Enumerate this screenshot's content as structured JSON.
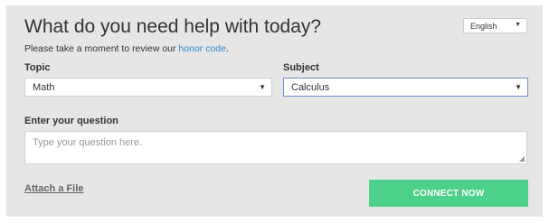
{
  "header": {
    "title": "What do you need help with today?",
    "subline_prefix": "Please take a moment to review our ",
    "honor_code_link": "honor code",
    "subline_suffix": "."
  },
  "language_select": {
    "value": "English",
    "caret": "▼"
  },
  "topic": {
    "label": "Topic",
    "value": "Math",
    "caret": "▼"
  },
  "subject": {
    "label": "Subject",
    "value": "Calculus",
    "caret": "▼"
  },
  "question": {
    "label": "Enter your question",
    "placeholder": "Type your question here.",
    "value": ""
  },
  "actions": {
    "attach_label": "Attach a File",
    "connect_label": "CONNECT NOW"
  },
  "colors": {
    "panel_bg": "#e6e6e6",
    "link": "#2a8ad8",
    "connect_button": "#4dd08a",
    "focus_border": "#6f8fd1"
  }
}
